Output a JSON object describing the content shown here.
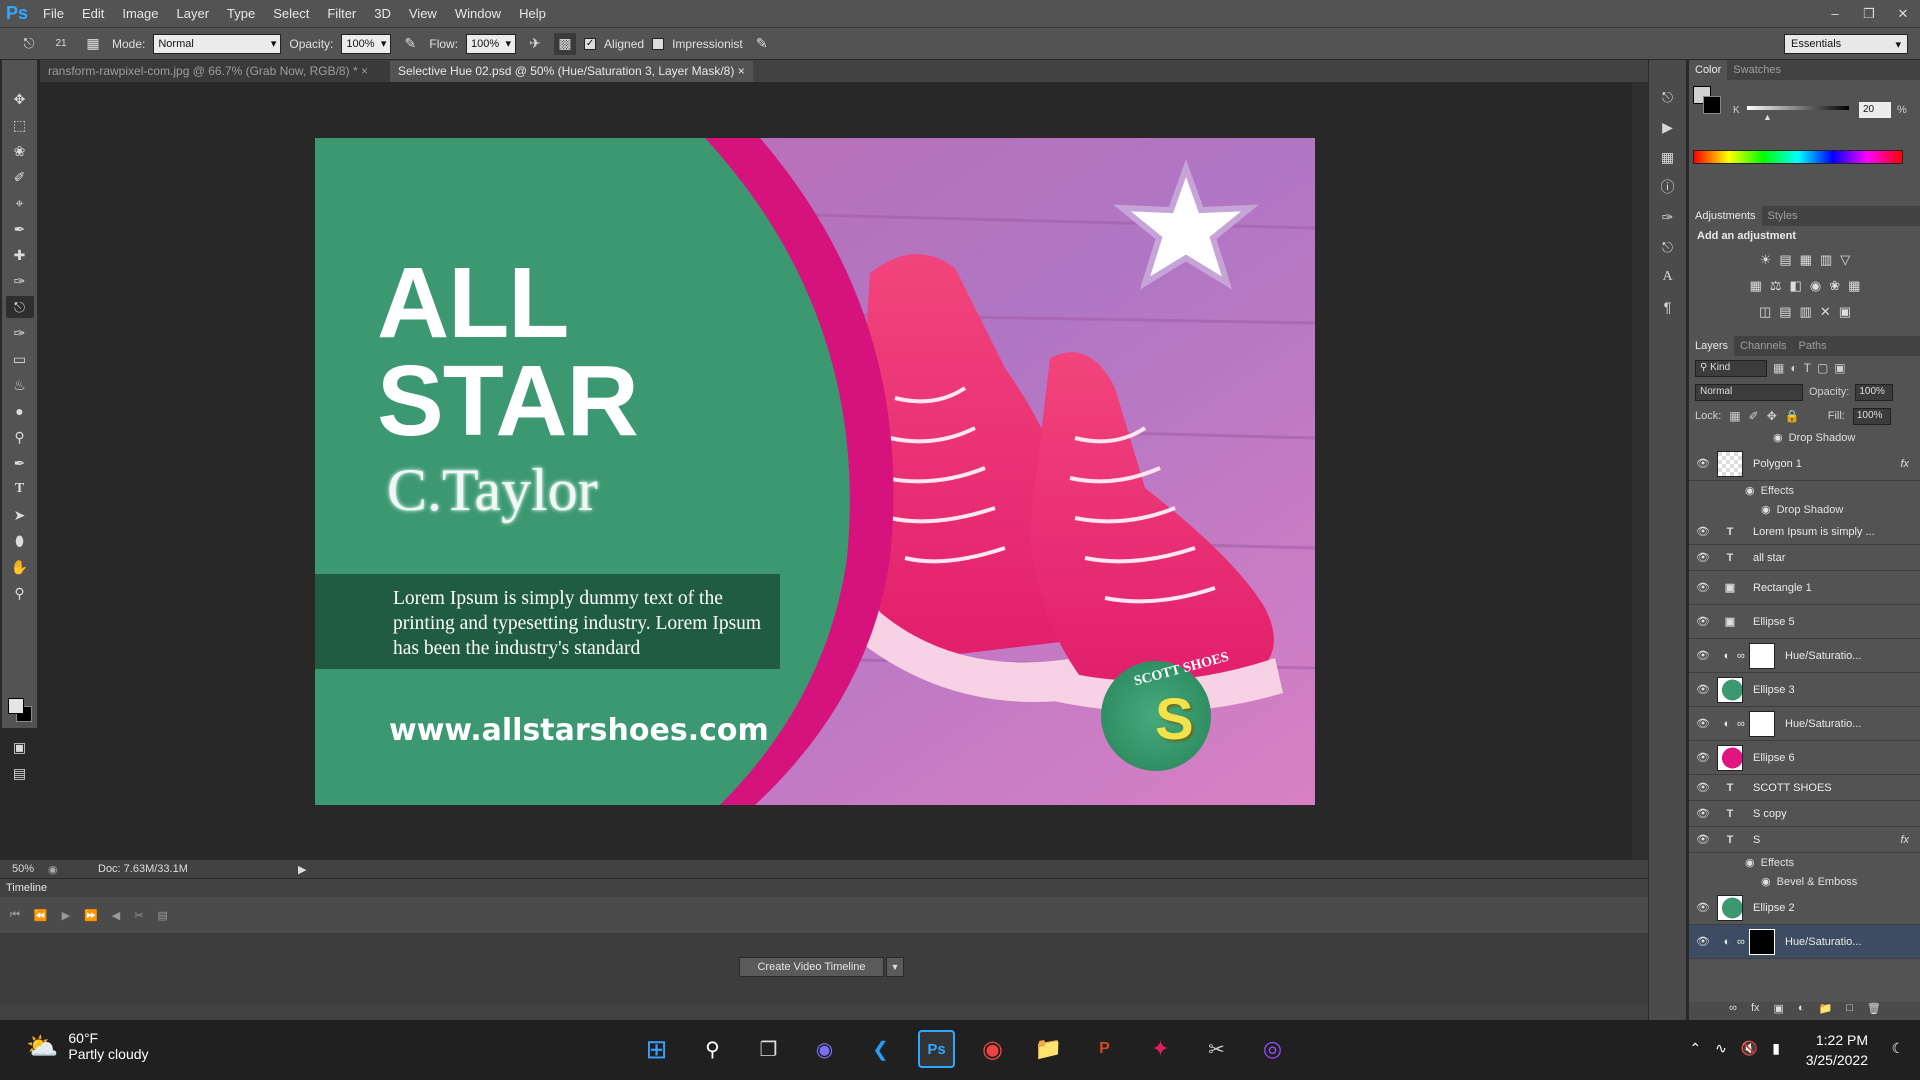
{
  "app": {
    "logo": "Ps"
  },
  "menu": [
    "File",
    "Edit",
    "Image",
    "Layer",
    "Type",
    "Select",
    "Filter",
    "3D",
    "View",
    "Window",
    "Help"
  ],
  "options": {
    "brush_size": "21",
    "mode_label": "Mode:",
    "mode_value": "Normal",
    "opacity_label": "Opacity:",
    "opacity_value": "100%",
    "flow_label": "Flow:",
    "flow_value": "100%",
    "aligned_label": "Aligned",
    "impressionist_label": "Impressionist",
    "workspace": "Essentials"
  },
  "doc_tabs": [
    {
      "label": "ransform-rawpixel-com.jpg @ 66.7% (Grab Now, RGB/8) *"
    },
    {
      "label": "Selective Hue 02.psd @ 50% (Hue/Saturation 3, Layer Mask/8)"
    }
  ],
  "design": {
    "title_line1": "ALL",
    "title_line2": "STAR",
    "name": "C.Taylor",
    "body": "Lorem Ipsum is simply dummy text of  the printing and typesetting industry. Lorem Ipsum has been the industry's standard",
    "url": "www.allstarshoes.com",
    "logo_text": "SCOTT SHOES",
    "logo_letter": "S"
  },
  "status": {
    "zoom": "50%",
    "doc": "Doc: 7.63M/33.1M"
  },
  "timeline": {
    "title": "Timeline",
    "create_button": "Create Video Timeline"
  },
  "color_panel": {
    "tabs": [
      "Color",
      "Swatches"
    ],
    "k_label": "K",
    "k_value": "20",
    "unit": "%"
  },
  "adjust_panel": {
    "tabs": [
      "Adjustments",
      "Styles"
    ],
    "heading": "Add an adjustment"
  },
  "layers_panel": {
    "tabs": [
      "Layers",
      "Channels",
      "Paths"
    ],
    "kind": "Kind",
    "blend": "Normal",
    "opacity_label": "Opacity:",
    "opacity_value": "100%",
    "lock_label": "Lock:",
    "fill_label": "Fill:",
    "fill_value": "100%",
    "top_effect": "Drop Shadow",
    "layers": [
      {
        "name": "Polygon 1",
        "type": "thumb-white",
        "fx": true,
        "effects": [
          "Effects",
          "Drop Shadow"
        ]
      },
      {
        "name": "Lorem Ipsum is simply ...",
        "type": "text"
      },
      {
        "name": "all star",
        "type": "text"
      },
      {
        "name": "Rectangle 1",
        "type": "shape"
      },
      {
        "name": "Ellipse 5",
        "type": "shape"
      },
      {
        "name": "Hue/Saturatio...",
        "type": "adjust-white"
      },
      {
        "name": "Ellipse 3",
        "type": "thumb-green"
      },
      {
        "name": "Hue/Saturatio...",
        "type": "adjust-white"
      },
      {
        "name": "Ellipse 6",
        "type": "thumb-pink"
      },
      {
        "name": "SCOTT SHOES",
        "type": "text"
      },
      {
        "name": "S copy",
        "type": "text"
      },
      {
        "name": "S",
        "type": "text",
        "fx": true,
        "effects": [
          "Effects",
          "Bevel & Emboss"
        ]
      },
      {
        "name": "Ellipse 2",
        "type": "thumb-green"
      },
      {
        "name": "Hue/Saturatio...",
        "type": "adjust-black",
        "selected": true
      }
    ]
  },
  "taskbar": {
    "temp": "60°F",
    "weather": "Partly cloudy",
    "time": "1:22 PM",
    "date": "3/25/2022"
  },
  "colors": {
    "accent_green": "#3b9871",
    "accent_magenta": "#d6127d",
    "body_box": "#1f5c41"
  }
}
